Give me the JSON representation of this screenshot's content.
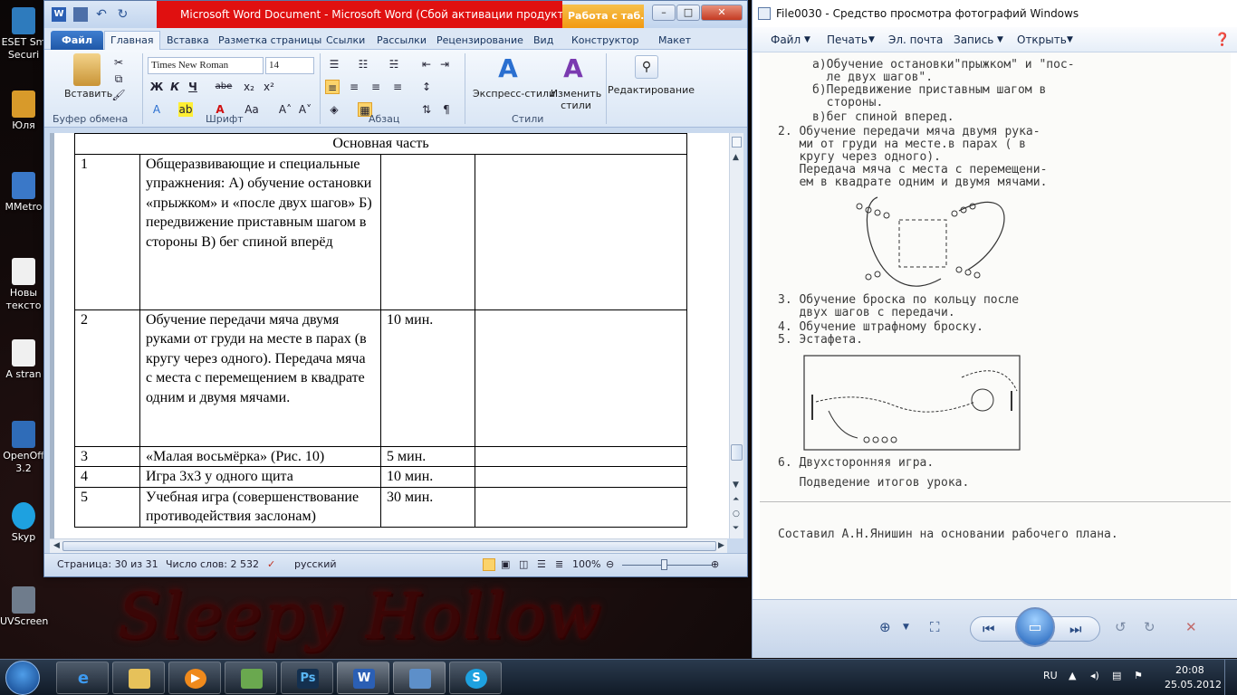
{
  "desktop": {
    "icons": [
      {
        "label": "ESET Sm Securi",
        "color": "#2e7bbd"
      },
      {
        "label": "Юля",
        "color": "#d89a2a"
      },
      {
        "label": "MMetro",
        "color": "#3a78c8"
      },
      {
        "label": "Новы тексто",
        "color": "#f0f0f0"
      },
      {
        "label": "A stran",
        "color": "#f0f0f0"
      },
      {
        "label": "OpenOff 3.2",
        "color": "#2f6cb8"
      },
      {
        "label": "Skyp",
        "color": "#1ea1e0"
      },
      {
        "label": "UVScreen",
        "color": "#6f7c8c"
      }
    ],
    "wallpaper_text": "Sleepy Hollow"
  },
  "word": {
    "title": "Microsoft Word Document  -  Microsoft Word (Сбой активации продукта)",
    "context_tab": "Работа с таб...",
    "tabs": [
      "Файл",
      "Главная",
      "Вставка",
      "Разметка страницы",
      "Ссылки",
      "Рассылки",
      "Рецензирование",
      "Вид",
      "Конструктор",
      "Макет"
    ],
    "ribbon": {
      "paste": "Вставить",
      "clipboard": "Буфер обмена",
      "font_name": "Times New Roman",
      "font_size": "14",
      "font": "Шрифт",
      "paragraph": "Абзац",
      "express_styles": "Экспресс-стили",
      "change_styles": "Изменить стили",
      "styles": "Стили",
      "editing": "Редактирование",
      "bold": "Ж",
      "italic": "К",
      "underline": "Ч",
      "strike": "abe",
      "sub": "x₂",
      "sup": "x²"
    },
    "table": {
      "header": "Основная часть",
      "rows": [
        {
          "num": "1",
          "text": "Общеразвивающие и специальные упражнения: А) обучение остановки «прыжком» и «после двух шагов» Б) передвижение приставным шагом в стороны В) бег спиной вперёд",
          "time": "",
          "note": ""
        },
        {
          "num": "2",
          "text": "Обучение передачи мяча двумя руками от груди на месте в парах (в кругу через одного). Передача мяча с места с перемещением в квадрате одним и двумя мячами.",
          "time": "10 мин.",
          "note": ""
        },
        {
          "num": "3",
          "text": "«Малая восьмёрка» (Рис. 10)",
          "time": "5 мин.",
          "note": ""
        },
        {
          "num": "4",
          "text": "Игра 3х3 у одного щита",
          "time": "10 мин.",
          "note": ""
        },
        {
          "num": "5",
          "text": "Учебная игра (совершенствование противодействия заслонам)",
          "time": "30 мин.",
          "note": ""
        }
      ]
    },
    "status": {
      "page": "Страница: 30 из 31",
      "words": "Число слов: 2 532",
      "lang": "русский",
      "zoom": "100%"
    }
  },
  "photo": {
    "title": "File0030 - Средство просмотра фотографий Windows",
    "menu": [
      "Файл",
      "Печать",
      "Эл. почта",
      "Запись",
      "Открыть"
    ],
    "scan_lines": [
      "а)Обучение остановки\"прыжком\" и \"пос-",
      "  ле двух шагов\".",
      "б)Передвижение приставным шагом в",
      "  стороны.",
      "в)бег спиной вперед.",
      "2. Обучение передачи мяча двумя рука-",
      "   ми от груди на месте.в парах ( в",
      "   кругу через одного).",
      "   Передача мяча с места с перемещени-",
      "   ем в квадрате одним и двумя мячами.",
      "3. Обучение броска по кольцу после",
      "   двух шагов с передачи.",
      "4. Обучение штрафному броску.",
      "5. Эстафета.",
      "6. Двухсторонняя игра.",
      "   Подведение итогов урока.",
      "Составил А.Н.Янишин на основании рабочего плана."
    ]
  },
  "tray": {
    "lang": "RU",
    "time": "20:08",
    "date": "25.05.2012"
  }
}
